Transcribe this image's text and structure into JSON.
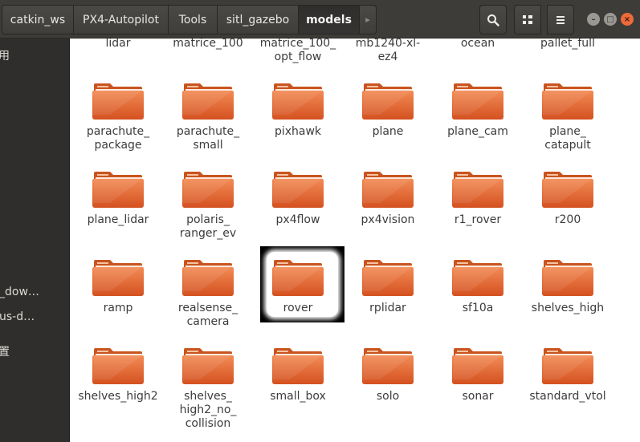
{
  "header": {
    "breadcrumbs": [
      {
        "label": "catkin_ws",
        "active": false
      },
      {
        "label": "PX4-Autopilot",
        "active": false
      },
      {
        "label": "Tools",
        "active": false
      },
      {
        "label": "sitl_gazebo",
        "active": false
      },
      {
        "label": "models",
        "active": true
      }
    ],
    "more_glyph": "▸",
    "buttons": {
      "search_icon": "search-icon",
      "view_icon": "grid-view-icon",
      "menu_icon": "hamburger-menu-icon"
    },
    "window_controls": {
      "minimize": "–",
      "maximize": "□",
      "close": "×"
    }
  },
  "sidebar": {
    "items": [
      "用",
      "_dow…",
      "us-d…",
      "置"
    ]
  },
  "selected_item": "rover",
  "rows": [
    [
      {
        "label": "lidar"
      },
      {
        "label": "matrice_100"
      },
      {
        "label": "matrice_100_\nopt_flow"
      },
      {
        "label": "mb1240-xl-\nez4"
      },
      {
        "label": "ocean"
      },
      {
        "label": "pallet_full"
      }
    ],
    [
      {
        "label": "parachute_\npackage"
      },
      {
        "label": "parachute_\nsmall"
      },
      {
        "label": "pixhawk"
      },
      {
        "label": "plane"
      },
      {
        "label": "plane_cam"
      },
      {
        "label": "plane_\ncatapult"
      }
    ],
    [
      {
        "label": "plane_lidar"
      },
      {
        "label": "polaris_\nranger_ev"
      },
      {
        "label": "px4flow"
      },
      {
        "label": "px4vision"
      },
      {
        "label": "r1_rover"
      },
      {
        "label": "r200"
      }
    ],
    [
      {
        "label": "ramp"
      },
      {
        "label": "realsense_\ncamera"
      },
      {
        "label": "rover"
      },
      {
        "label": "rplidar"
      },
      {
        "label": "sf10a"
      },
      {
        "label": "shelves_high"
      }
    ],
    [
      {
        "label": "shelves_high2"
      },
      {
        "label": "shelves_\nhigh2_no_\ncollision"
      },
      {
        "label": "small_box"
      },
      {
        "label": "solo"
      },
      {
        "label": "sonar"
      },
      {
        "label": "standard_vtol"
      }
    ]
  ],
  "colors": {
    "folder_top": "#f28b55",
    "folder_bottom": "#d45120",
    "folder_tab": "#c9541f",
    "header_bg": "#3d3c38",
    "sidebar_bg": "#2f2e2c",
    "close_btn": "#ee6a3b"
  }
}
